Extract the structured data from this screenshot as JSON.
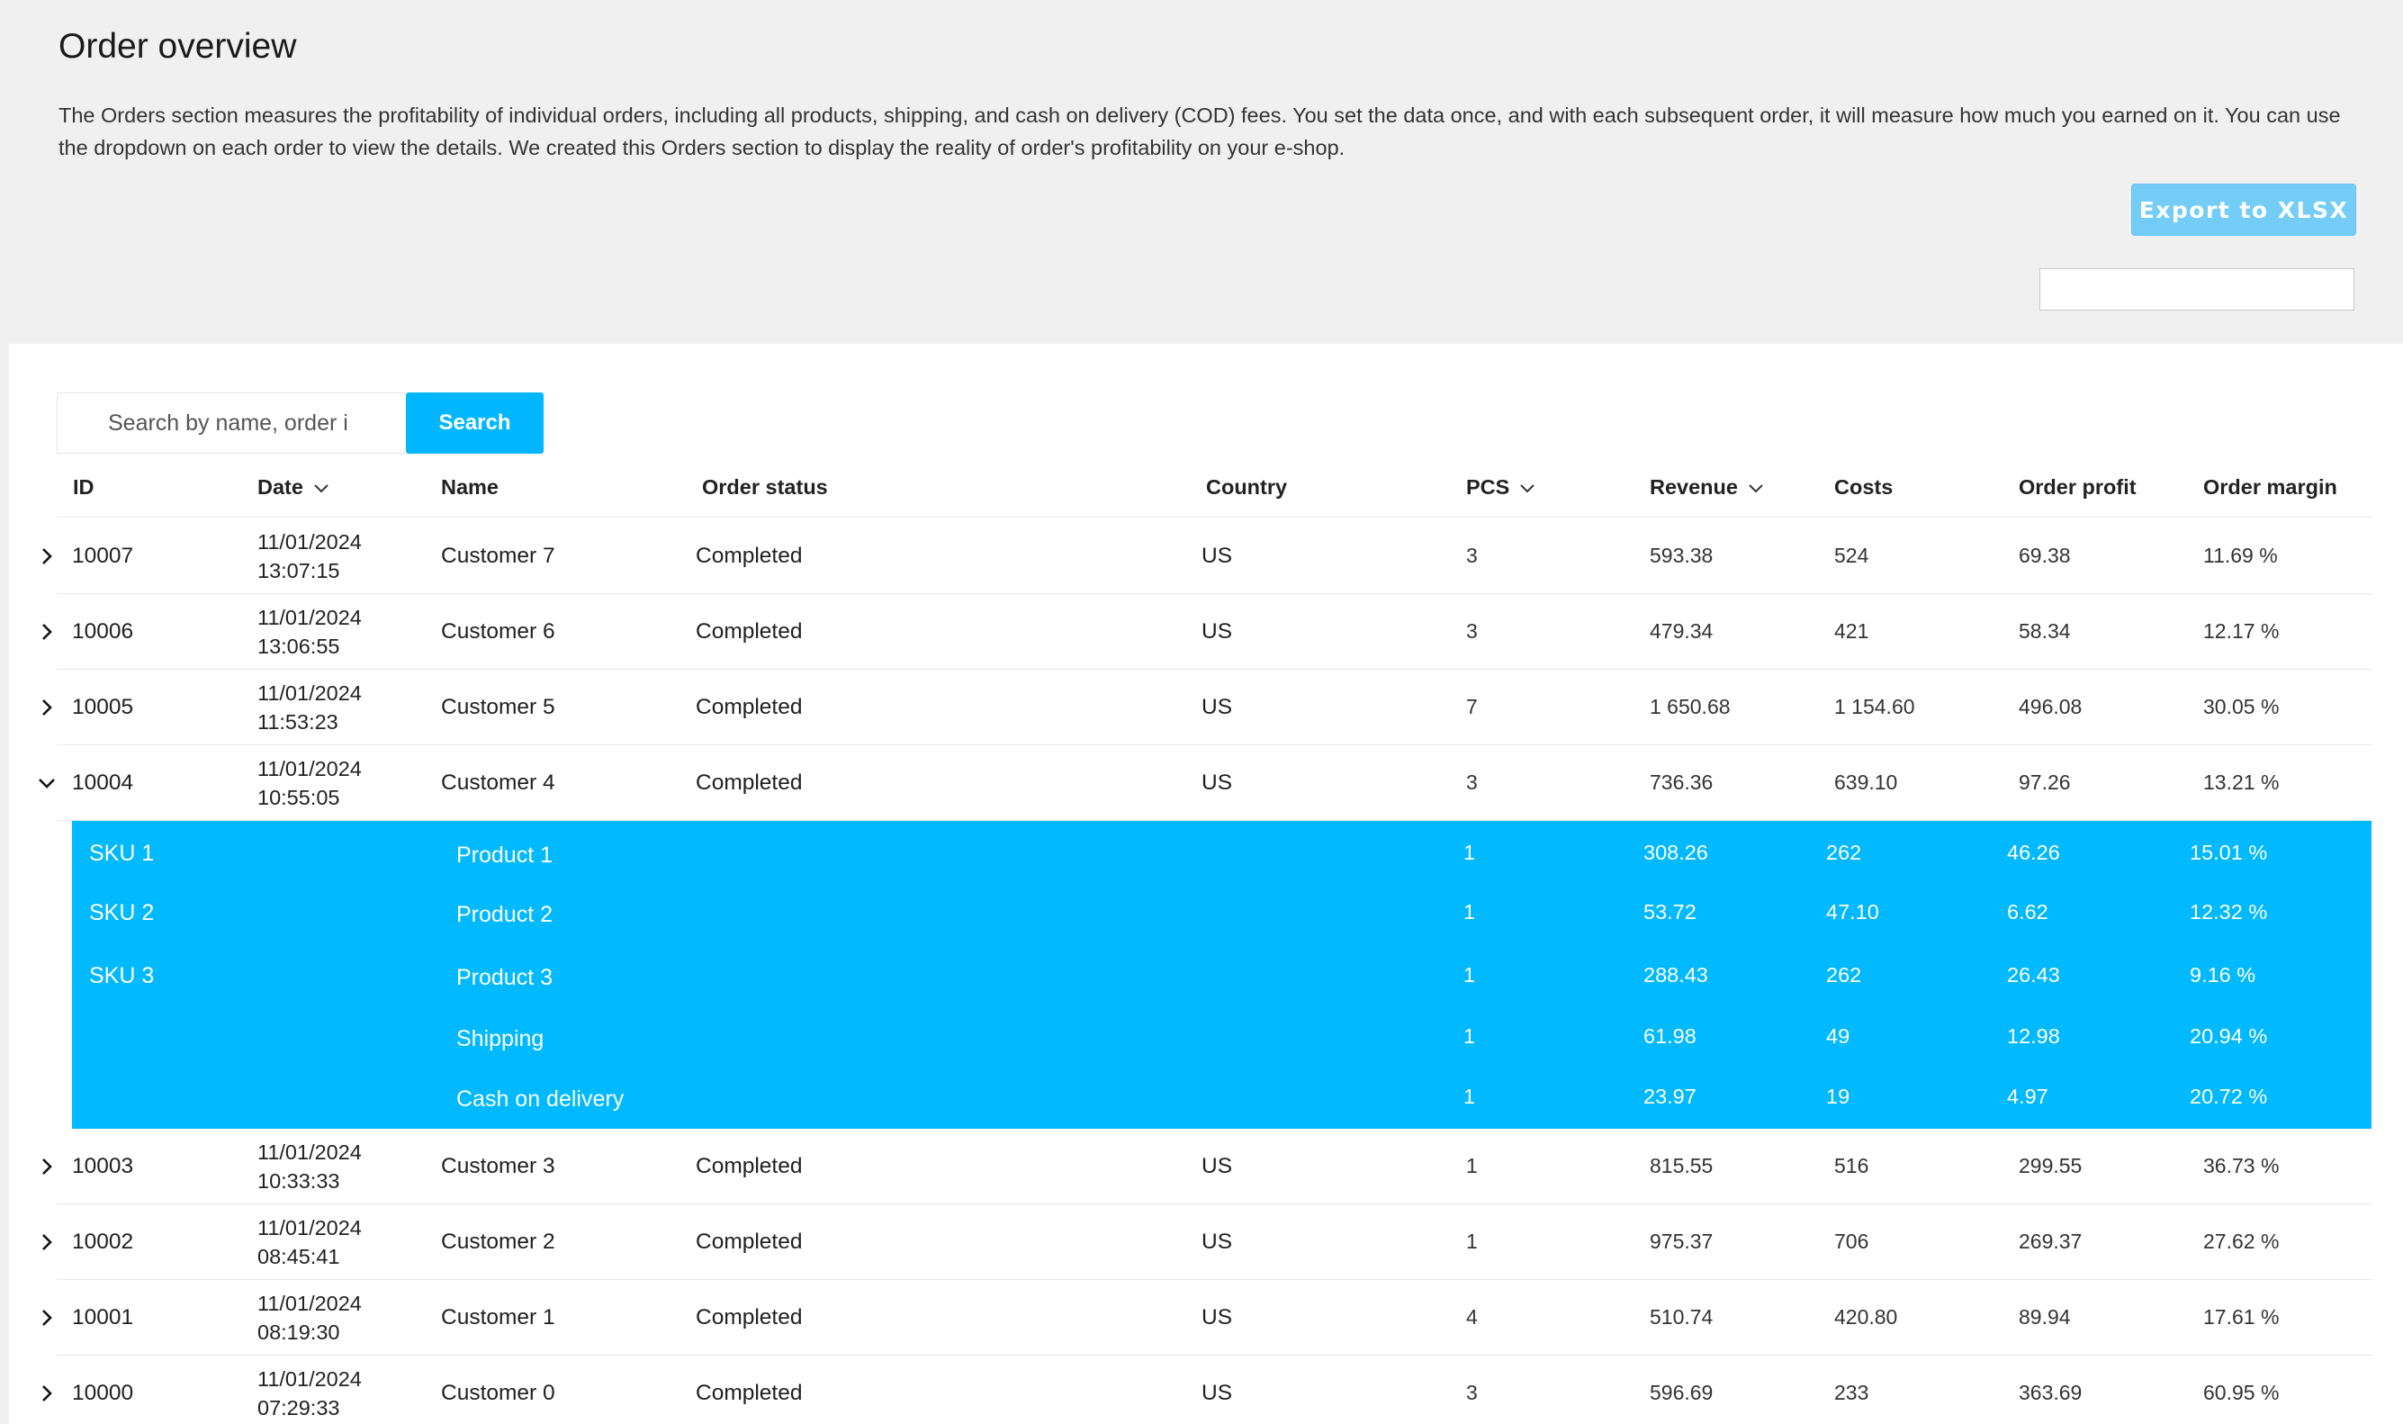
{
  "header": {
    "title": "Order overview",
    "description": "The Orders section measures the profitability of individual orders, including all products, shipping, and cash on delivery (COD) fees. You set the data once, and with each subsequent order, it will measure how much you earned on it. You can use the dropdown on each order to view the details. We created this Orders section to display the reality of order's profitability on your e-shop.",
    "export_label": "Export to XLSX"
  },
  "search": {
    "placeholder": "Search by name, order i",
    "button_label": "Search"
  },
  "columns": {
    "id": "ID",
    "date": "Date",
    "name": "Name",
    "status": "Order status",
    "country": "Country",
    "pcs": "PCS",
    "revenue": "Revenue",
    "costs": "Costs",
    "profit": "Order profit",
    "margin": "Order margin"
  },
  "orders": [
    {
      "id": "10007",
      "date": "11/01/2024",
      "time": "13:07:15",
      "name": "Customer 7",
      "status": "Completed",
      "country": "US",
      "pcs": "3",
      "revenue": "593.38",
      "costs": "524",
      "profit": "69.38",
      "margin": "11.69 %"
    },
    {
      "id": "10006",
      "date": "11/01/2024",
      "time": "13:06:55",
      "name": "Customer 6",
      "status": "Completed",
      "country": "US",
      "pcs": "3",
      "revenue": "479.34",
      "costs": "421",
      "profit": "58.34",
      "margin": "12.17 %"
    },
    {
      "id": "10005",
      "date": "11/01/2024",
      "time": "11:53:23",
      "name": "Customer 5",
      "status": "Completed",
      "country": "US",
      "pcs": "7",
      "revenue": "1 650.68",
      "costs": "1 154.60",
      "profit": "496.08",
      "margin": "30.05 %"
    },
    {
      "id": "10004",
      "date": "11/01/2024",
      "time": "10:55:05",
      "name": "Customer 4",
      "status": "Completed",
      "country": "US",
      "pcs": "3",
      "revenue": "736.36",
      "costs": "639.10",
      "profit": "97.26",
      "margin": "13.21 %"
    },
    {
      "id": "10003",
      "date": "11/01/2024",
      "time": "10:33:33",
      "name": "Customer 3",
      "status": "Completed",
      "country": "US",
      "pcs": "1",
      "revenue": "815.55",
      "costs": "516",
      "profit": "299.55",
      "margin": "36.73 %"
    },
    {
      "id": "10002",
      "date": "11/01/2024",
      "time": "08:45:41",
      "name": "Customer 2",
      "status": "Completed",
      "country": "US",
      "pcs": "1",
      "revenue": "975.37",
      "costs": "706",
      "profit": "269.37",
      "margin": "27.62 %"
    },
    {
      "id": "10001",
      "date": "11/01/2024",
      "time": "08:19:30",
      "name": "Customer 1",
      "status": "Completed",
      "country": "US",
      "pcs": "4",
      "revenue": "510.74",
      "costs": "420.80",
      "profit": "89.94",
      "margin": "17.61 %"
    },
    {
      "id": "10000",
      "date": "11/01/2024",
      "time": "07:29:33",
      "name": "Customer 0",
      "status": "Completed",
      "country": "US",
      "pcs": "3",
      "revenue": "596.69",
      "costs": "233",
      "profit": "363.69",
      "margin": "60.95 %"
    }
  ],
  "order_details": [
    {
      "sku": "SKU 1",
      "product": "Product 1",
      "pcs": "1",
      "revenue": "308.26",
      "costs": "262",
      "profit": "46.26",
      "margin": "15.01 %"
    },
    {
      "sku": "SKU 2",
      "product": "Product 2",
      "pcs": "1",
      "revenue": "53.72",
      "costs": "47.10",
      "profit": "6.62",
      "margin": "12.32 %"
    },
    {
      "sku": "SKU 3",
      "product": "Product 3",
      "pcs": "1",
      "revenue": "288.43",
      "costs": "262",
      "profit": "26.43",
      "margin": "9.16 %"
    },
    {
      "sku": "",
      "product": "Shipping",
      "pcs": "1",
      "revenue": "61.98",
      "costs": "49",
      "profit": "12.98",
      "margin": "20.94 %"
    },
    {
      "sku": "",
      "product": "Cash on delivery",
      "pcs": "1",
      "revenue": "23.97",
      "costs": "19",
      "profit": "4.97",
      "margin": "20.72 %"
    }
  ],
  "icons": {
    "expand": "chevron-right-icon",
    "collapse": "chevron-down-icon",
    "sort": "sort-down-icon"
  },
  "colors": {
    "accent": "#00b7ff",
    "detail_background": "#00b9fe",
    "export_button": "#74cdf6"
  }
}
